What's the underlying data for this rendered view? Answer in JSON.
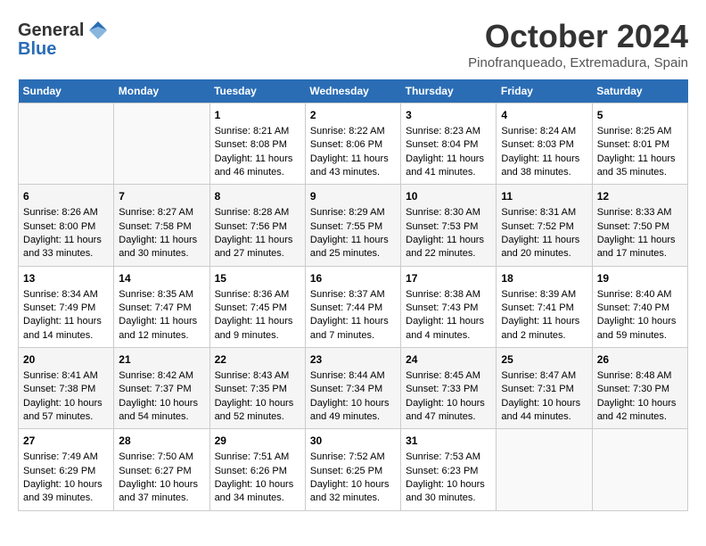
{
  "header": {
    "logo_line1": "General",
    "logo_line2": "Blue",
    "month": "October 2024",
    "location": "Pinofranqueado, Extremadura, Spain"
  },
  "weekdays": [
    "Sunday",
    "Monday",
    "Tuesday",
    "Wednesday",
    "Thursday",
    "Friday",
    "Saturday"
  ],
  "weeks": [
    [
      {
        "day": "",
        "content": ""
      },
      {
        "day": "",
        "content": ""
      },
      {
        "day": "1",
        "sunrise": "8:21 AM",
        "sunset": "8:08 PM",
        "daylight": "11 hours and 46 minutes."
      },
      {
        "day": "2",
        "sunrise": "8:22 AM",
        "sunset": "8:06 PM",
        "daylight": "11 hours and 43 minutes."
      },
      {
        "day": "3",
        "sunrise": "8:23 AM",
        "sunset": "8:04 PM",
        "daylight": "11 hours and 41 minutes."
      },
      {
        "day": "4",
        "sunrise": "8:24 AM",
        "sunset": "8:03 PM",
        "daylight": "11 hours and 38 minutes."
      },
      {
        "day": "5",
        "sunrise": "8:25 AM",
        "sunset": "8:01 PM",
        "daylight": "11 hours and 35 minutes."
      }
    ],
    [
      {
        "day": "6",
        "sunrise": "8:26 AM",
        "sunset": "8:00 PM",
        "daylight": "11 hours and 33 minutes."
      },
      {
        "day": "7",
        "sunrise": "8:27 AM",
        "sunset": "7:58 PM",
        "daylight": "11 hours and 30 minutes."
      },
      {
        "day": "8",
        "sunrise": "8:28 AM",
        "sunset": "7:56 PM",
        "daylight": "11 hours and 27 minutes."
      },
      {
        "day": "9",
        "sunrise": "8:29 AM",
        "sunset": "7:55 PM",
        "daylight": "11 hours and 25 minutes."
      },
      {
        "day": "10",
        "sunrise": "8:30 AM",
        "sunset": "7:53 PM",
        "daylight": "11 hours and 22 minutes."
      },
      {
        "day": "11",
        "sunrise": "8:31 AM",
        "sunset": "7:52 PM",
        "daylight": "11 hours and 20 minutes."
      },
      {
        "day": "12",
        "sunrise": "8:33 AM",
        "sunset": "7:50 PM",
        "daylight": "11 hours and 17 minutes."
      }
    ],
    [
      {
        "day": "13",
        "sunrise": "8:34 AM",
        "sunset": "7:49 PM",
        "daylight": "11 hours and 14 minutes."
      },
      {
        "day": "14",
        "sunrise": "8:35 AM",
        "sunset": "7:47 PM",
        "daylight": "11 hours and 12 minutes."
      },
      {
        "day": "15",
        "sunrise": "8:36 AM",
        "sunset": "7:45 PM",
        "daylight": "11 hours and 9 minutes."
      },
      {
        "day": "16",
        "sunrise": "8:37 AM",
        "sunset": "7:44 PM",
        "daylight": "11 hours and 7 minutes."
      },
      {
        "day": "17",
        "sunrise": "8:38 AM",
        "sunset": "7:43 PM",
        "daylight": "11 hours and 4 minutes."
      },
      {
        "day": "18",
        "sunrise": "8:39 AM",
        "sunset": "7:41 PM",
        "daylight": "11 hours and 2 minutes."
      },
      {
        "day": "19",
        "sunrise": "8:40 AM",
        "sunset": "7:40 PM",
        "daylight": "10 hours and 59 minutes."
      }
    ],
    [
      {
        "day": "20",
        "sunrise": "8:41 AM",
        "sunset": "7:38 PM",
        "daylight": "10 hours and 57 minutes."
      },
      {
        "day": "21",
        "sunrise": "8:42 AM",
        "sunset": "7:37 PM",
        "daylight": "10 hours and 54 minutes."
      },
      {
        "day": "22",
        "sunrise": "8:43 AM",
        "sunset": "7:35 PM",
        "daylight": "10 hours and 52 minutes."
      },
      {
        "day": "23",
        "sunrise": "8:44 AM",
        "sunset": "7:34 PM",
        "daylight": "10 hours and 49 minutes."
      },
      {
        "day": "24",
        "sunrise": "8:45 AM",
        "sunset": "7:33 PM",
        "daylight": "10 hours and 47 minutes."
      },
      {
        "day": "25",
        "sunrise": "8:47 AM",
        "sunset": "7:31 PM",
        "daylight": "10 hours and 44 minutes."
      },
      {
        "day": "26",
        "sunrise": "8:48 AM",
        "sunset": "7:30 PM",
        "daylight": "10 hours and 42 minutes."
      }
    ],
    [
      {
        "day": "27",
        "sunrise": "7:49 AM",
        "sunset": "6:29 PM",
        "daylight": "10 hours and 39 minutes."
      },
      {
        "day": "28",
        "sunrise": "7:50 AM",
        "sunset": "6:27 PM",
        "daylight": "10 hours and 37 minutes."
      },
      {
        "day": "29",
        "sunrise": "7:51 AM",
        "sunset": "6:26 PM",
        "daylight": "10 hours and 34 minutes."
      },
      {
        "day": "30",
        "sunrise": "7:52 AM",
        "sunset": "6:25 PM",
        "daylight": "10 hours and 32 minutes."
      },
      {
        "day": "31",
        "sunrise": "7:53 AM",
        "sunset": "6:23 PM",
        "daylight": "10 hours and 30 minutes."
      },
      {
        "day": "",
        "content": ""
      },
      {
        "day": "",
        "content": ""
      }
    ]
  ]
}
